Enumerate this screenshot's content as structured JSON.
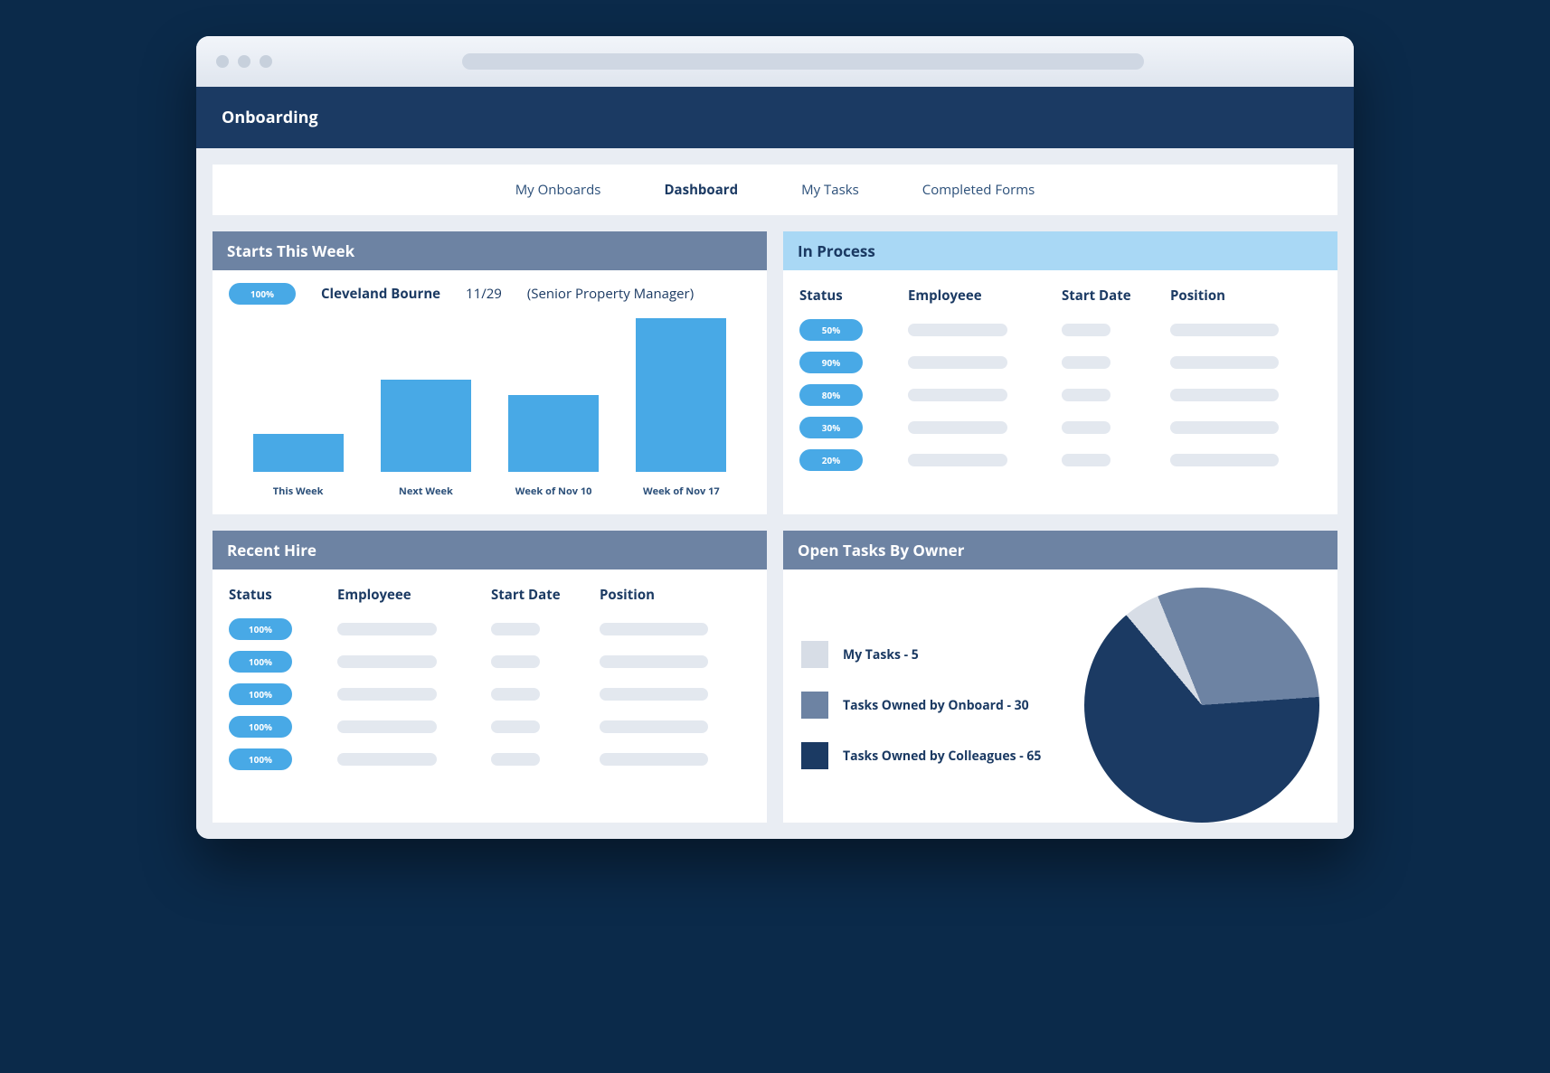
{
  "app_title": "Onboarding",
  "tabs": {
    "items": [
      "My Onboards",
      "Dashboard",
      "My Tasks",
      "Completed Forms"
    ],
    "active": "Dashboard"
  },
  "starts_this_week": {
    "title": "Starts This Week",
    "pill": "100%",
    "name": "Cleveland Bourne",
    "date": "11/29",
    "position": "(Senior Property Manager)"
  },
  "in_process": {
    "title": "In Process",
    "columns": [
      "Status",
      "Employeee",
      "Start Date",
      "Position"
    ],
    "rows": [
      {
        "status": "50%"
      },
      {
        "status": "90%"
      },
      {
        "status": "80%"
      },
      {
        "status": "30%"
      },
      {
        "status": "20%"
      }
    ]
  },
  "recent_hire": {
    "title": "Recent Hire",
    "columns": [
      "Status",
      "Employeee",
      "Start Date",
      "Position"
    ],
    "rows": [
      {
        "status": "100%"
      },
      {
        "status": "100%"
      },
      {
        "status": "100%"
      },
      {
        "status": "100%"
      },
      {
        "status": "100%"
      }
    ]
  },
  "open_tasks": {
    "title": "Open Tasks By Owner",
    "legend": [
      {
        "label": "My Tasks - 5",
        "color": "#d7dde6"
      },
      {
        "label": "Tasks Owned by Onboard - 30",
        "color": "#6d83a3"
      },
      {
        "label": "Tasks Owned by Colleagues - 65",
        "color": "#1b3a63"
      }
    ]
  },
  "chart_data": [
    {
      "type": "bar",
      "title": "Starts This Week",
      "categories": [
        "This Week",
        "Next Week",
        "Week of Nov 10",
        "Week of Nov 17"
      ],
      "values": [
        25,
        60,
        50,
        100
      ],
      "ylim": [
        0,
        100
      ]
    },
    {
      "type": "pie",
      "title": "Open Tasks By Owner",
      "series": [
        {
          "name": "My Tasks",
          "value": 5,
          "color": "#d7dde6"
        },
        {
          "name": "Tasks Owned by Onboard",
          "value": 30,
          "color": "#6d83a3"
        },
        {
          "name": "Tasks Owned by Colleagues",
          "value": 65,
          "color": "#1b3a63"
        }
      ]
    }
  ]
}
